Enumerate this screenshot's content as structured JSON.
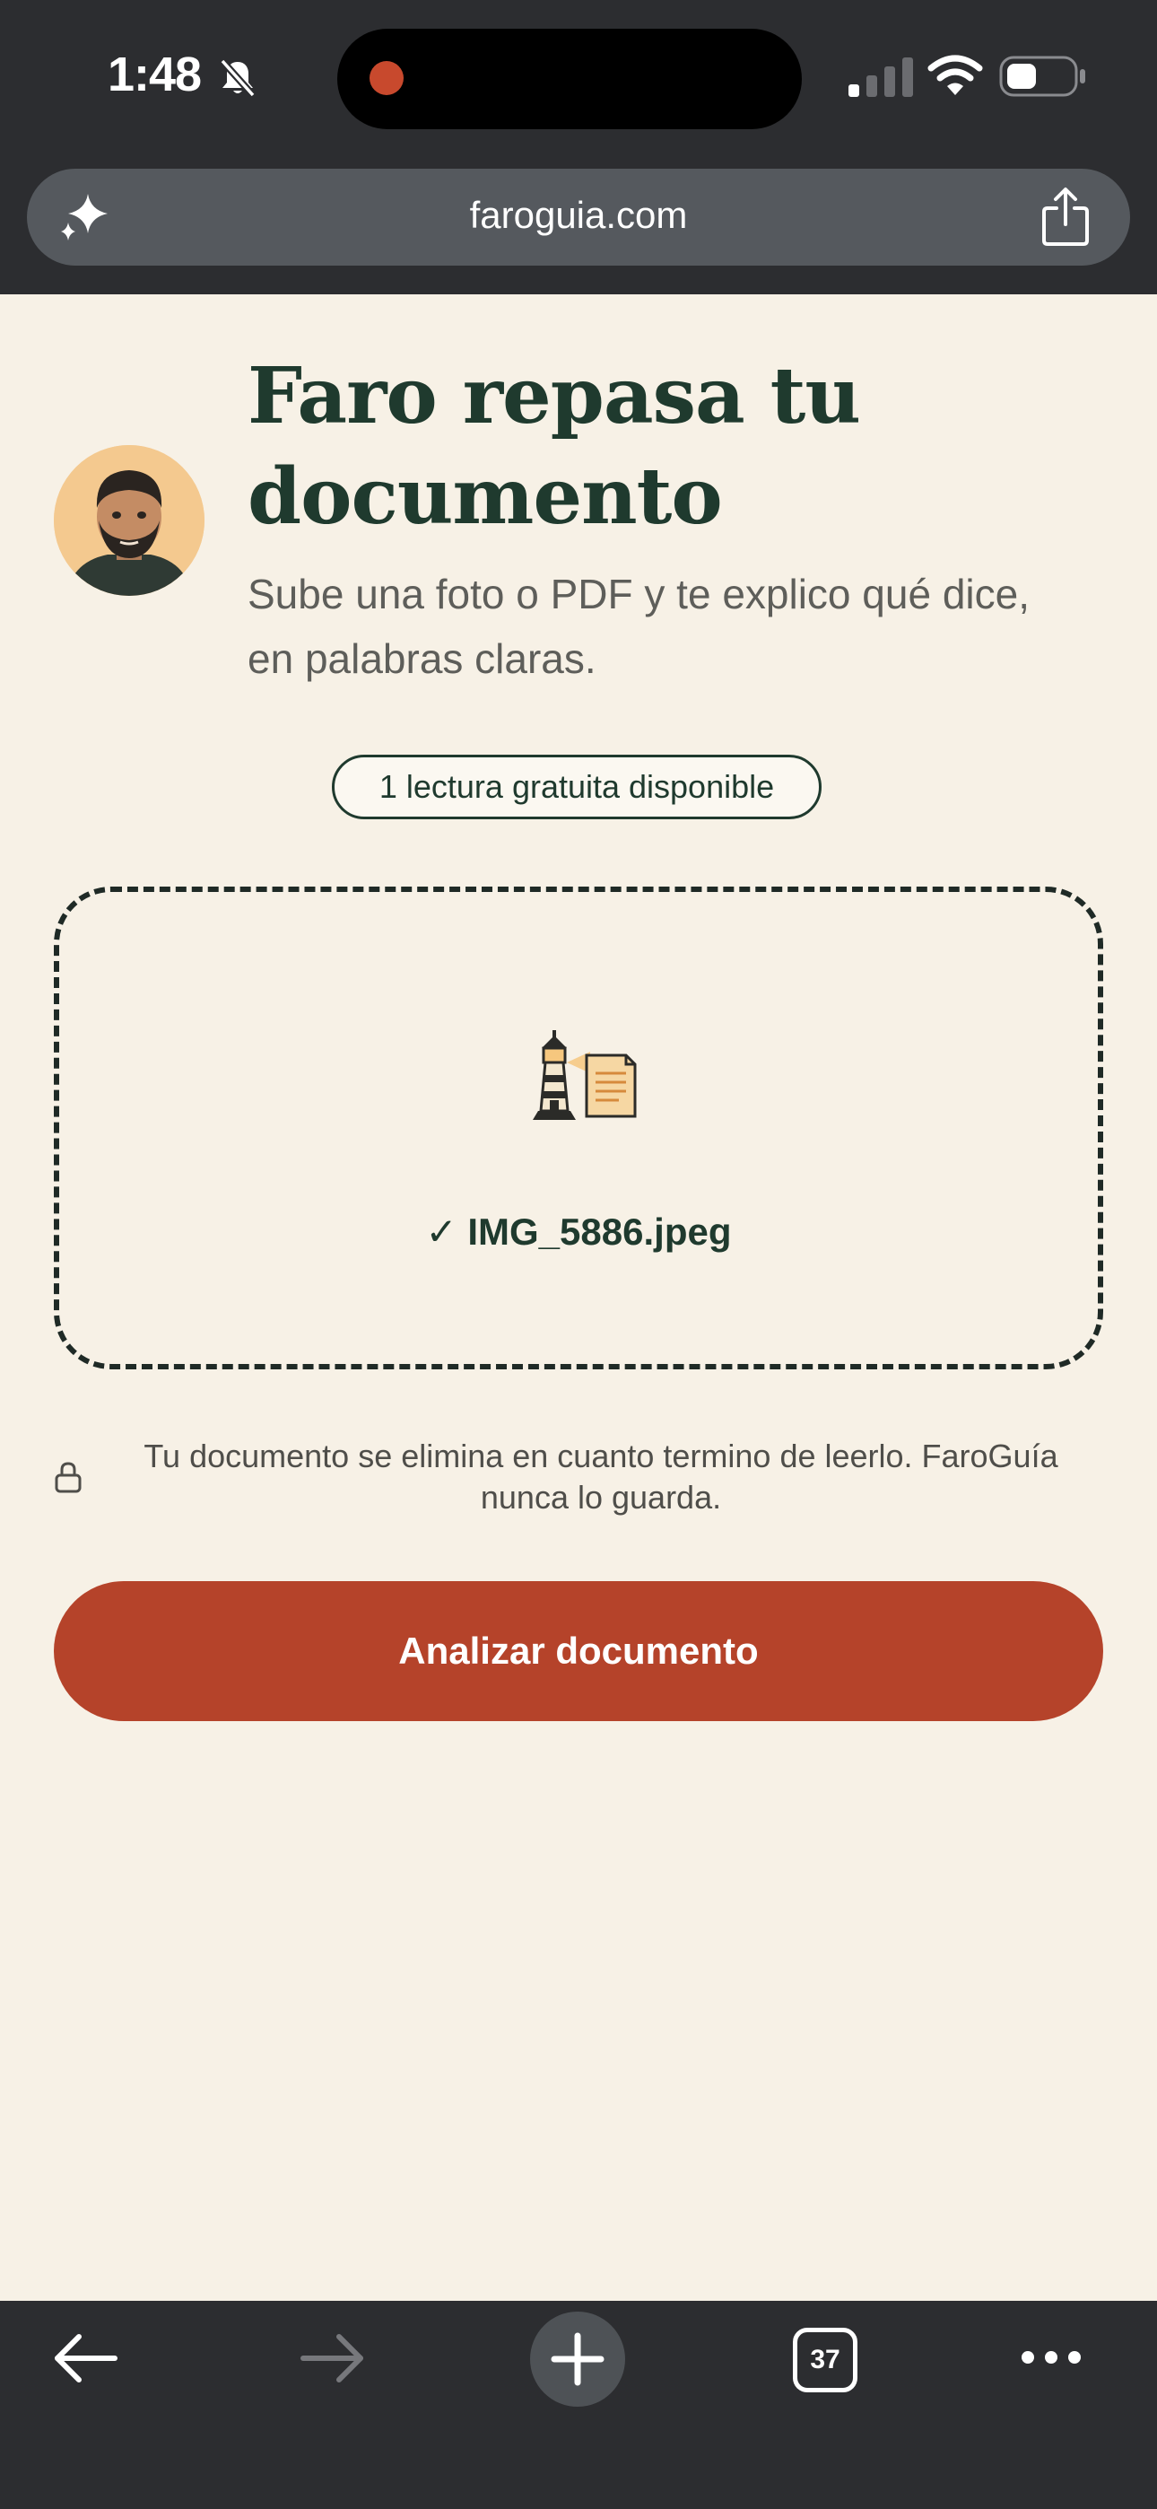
{
  "status_bar": {
    "time": "1:48",
    "icons": [
      "bell-slash-icon",
      "signal-icon",
      "wifi-icon",
      "battery-icon"
    ]
  },
  "browser": {
    "url": "faroguia.com",
    "left_icon": "sparkle-icon",
    "right_icon": "share-icon"
  },
  "header": {
    "title": "Faro repasa tu documento",
    "subtitle": "Sube una foto o PDF y te explico qué dice, en palabras claras."
  },
  "credits_badge": "1 lectura gratuita disponible",
  "upload": {
    "file_name": "✓ IMG_5886.jpeg",
    "icon": "lighthouse-document-icon"
  },
  "privacy": {
    "text": "Tu documento se elimina en cuanto termino de leerlo. FaroGuía nunca lo guarda.",
    "icon": "lock-icon"
  },
  "analyze_button": "Analizar documento",
  "toolbar": {
    "tab_count": "37",
    "icons": [
      "back-icon",
      "forward-icon",
      "plus-icon",
      "tabs-icon",
      "more-icon"
    ]
  },
  "colors": {
    "page_background": "#f7f1e6",
    "primary_green": "#1f3a2e",
    "accent_red": "#b5432a",
    "chrome_dark": "#2c2d30"
  }
}
